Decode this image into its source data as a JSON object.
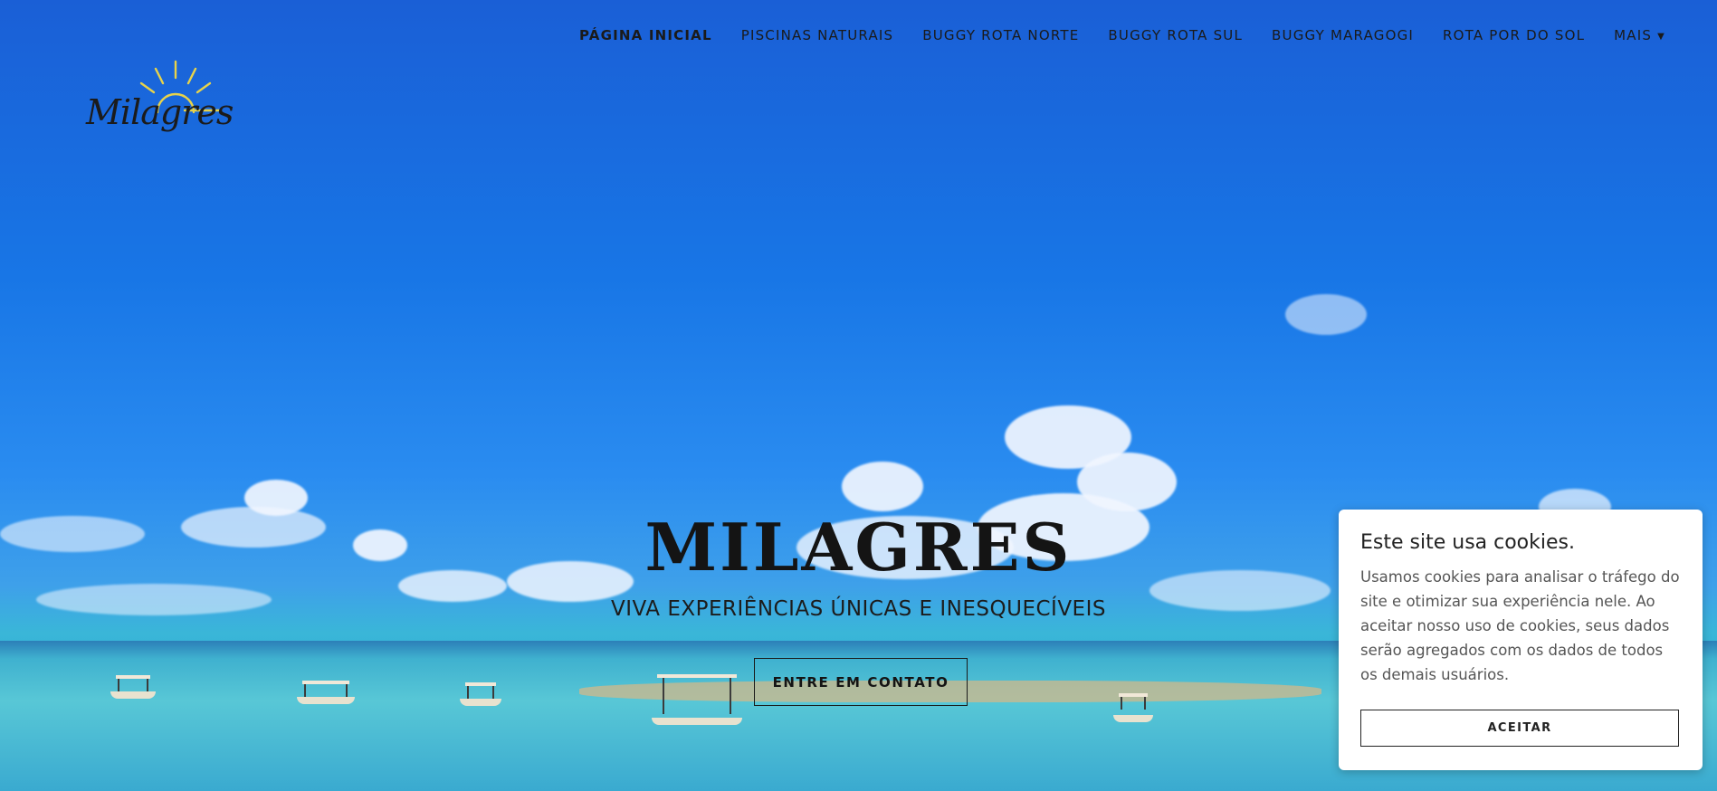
{
  "nav": {
    "items": [
      {
        "label": "PÁGINA INICIAL",
        "active": true
      },
      {
        "label": "PISCINAS NATURAIS",
        "active": false
      },
      {
        "label": "BUGGY ROTA NORTE",
        "active": false
      },
      {
        "label": "BUGGY ROTA SUL",
        "active": false
      },
      {
        "label": "BUGGY MARAGOGI",
        "active": false
      },
      {
        "label": "ROTA POR DO SOL",
        "active": false
      },
      {
        "label": "MAIS",
        "active": false
      }
    ],
    "more_caret": "▼"
  },
  "logo": {
    "text": "Milagres",
    "icon": "sun-icon",
    "sun_color": "#e8d34a"
  },
  "hero": {
    "title": "MILAGRES",
    "subtitle": "VIVA EXPERIÊNCIAS ÚNICAS E INESQUECÍVEIS",
    "cta_label": "ENTRE EM CONTATO"
  },
  "cookie_banner": {
    "title": "Este site usa cookies.",
    "text": "Usamos cookies para analisar o tráfego do site e otimizar sua experiência nele. Ao aceitar nosso uso de cookies, seus dados serão agregados com os dados de todos os demais usuários.",
    "accept_label": "ACEITAR"
  }
}
